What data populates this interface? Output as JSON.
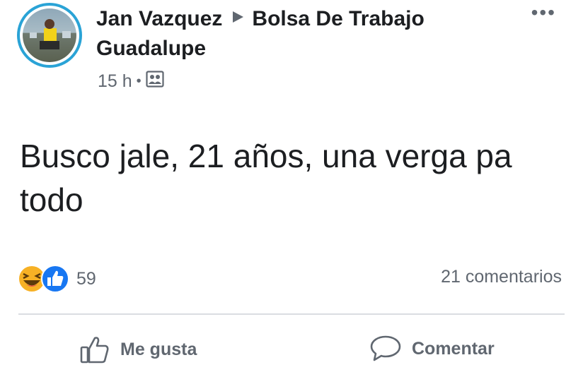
{
  "post": {
    "author": "Jan Vazquez",
    "group_line1": "Bolsa De Trabajo",
    "group_line2": "Guadalupe",
    "time": "15 h",
    "text": "Busco jale, 21 años, una verga pa todo"
  },
  "stats": {
    "reaction_count": "59",
    "comments_count": "21 comentarios"
  },
  "actions": {
    "like_label": "Me gusta",
    "comment_label": "Comentar"
  },
  "colors": {
    "like_blue": "#1877f2",
    "haha_yellow": "#f7b125",
    "avatar_ring": "#2aa3d6",
    "muted_text": "#606770"
  },
  "icons": {
    "menu": "more-horizontal-icon",
    "audience": "group-audience-icon",
    "like": "thumbs-up-outline-icon",
    "comment": "comment-bubble-icon"
  }
}
